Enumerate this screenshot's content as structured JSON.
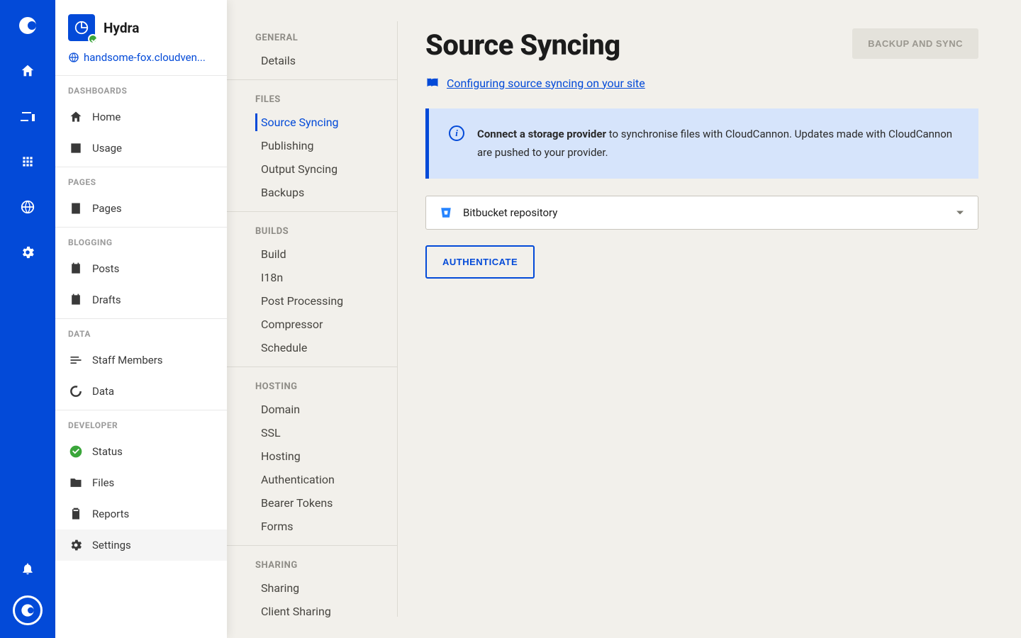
{
  "project": {
    "name": "Hydra",
    "url": "handsome-fox.cloudven..."
  },
  "sidebar": {
    "groups": [
      {
        "label": "DASHBOARDS",
        "items": [
          {
            "label": "Home",
            "icon": "house-icon"
          },
          {
            "label": "Usage",
            "icon": "chart-bar-icon"
          }
        ]
      },
      {
        "label": "PAGES",
        "items": [
          {
            "label": "Pages",
            "icon": "page-icon"
          }
        ]
      },
      {
        "label": "BLOGGING",
        "items": [
          {
            "label": "Posts",
            "icon": "calendar-check-icon"
          },
          {
            "label": "Drafts",
            "icon": "calendar-icon"
          }
        ]
      },
      {
        "label": "DATA",
        "items": [
          {
            "label": "Staff Members",
            "icon": "lines-icon"
          },
          {
            "label": "Data",
            "icon": "donut-icon"
          }
        ]
      },
      {
        "label": "DEVELOPER",
        "items": [
          {
            "label": "Status",
            "icon": "check-circle-icon",
            "status": true
          },
          {
            "label": "Files",
            "icon": "folder-icon"
          },
          {
            "label": "Reports",
            "icon": "clipboard-icon"
          },
          {
            "label": "Settings",
            "icon": "gear-icon",
            "active": true
          }
        ]
      }
    ]
  },
  "settings": {
    "groups": [
      {
        "heading": "GENERAL",
        "items": [
          "Details"
        ]
      },
      {
        "heading": "FILES",
        "items": [
          "Source Syncing",
          "Publishing",
          "Output Syncing",
          "Backups"
        ],
        "selected": "Source Syncing"
      },
      {
        "heading": "BUILDS",
        "items": [
          "Build",
          "I18n",
          "Post Processing",
          "Compressor",
          "Schedule"
        ]
      },
      {
        "heading": "HOSTING",
        "items": [
          "Domain",
          "SSL",
          "Hosting",
          "Authentication",
          "Bearer Tokens",
          "Forms"
        ]
      },
      {
        "heading": "SHARING",
        "items": [
          "Sharing",
          "Client Sharing"
        ]
      }
    ]
  },
  "main": {
    "title": "Source Syncing",
    "backup_btn": "BACKUP AND SYNC",
    "doc_link": "Configuring source syncing on your site",
    "info_strong": "Connect a storage provider",
    "info_rest": " to synchronise files with CloudCannon. Updates made with CloudCannon are pushed to your provider.",
    "select_label": "Bitbucket repository",
    "auth_btn": "AUTHENTICATE"
  }
}
